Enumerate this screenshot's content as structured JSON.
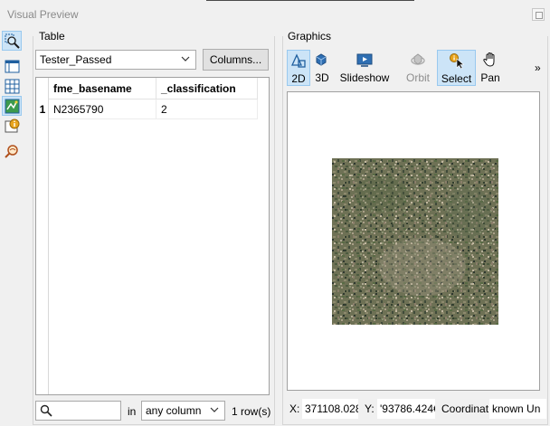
{
  "window": {
    "title": "Visual Preview"
  },
  "toolstrip": {
    "items": [
      {
        "icon": "zoom-selection-icon",
        "active": true
      },
      {
        "icon": "window-layout-icon",
        "active": false
      },
      {
        "icon": "table-view-icon",
        "active": false
      },
      {
        "icon": "graphics-view-icon",
        "active": false
      },
      {
        "icon": "feature-info-icon",
        "active": false
      },
      {
        "icon": "inspect-search-icon",
        "active": false
      }
    ]
  },
  "table_panel": {
    "label": "Table",
    "dataset_select": "Tester_Passed",
    "columns_button": "Columns...",
    "headers": [
      "fme_basename",
      "_classification"
    ],
    "rows": [
      {
        "num": "1",
        "cells": [
          "N2365790",
          "2"
        ]
      }
    ],
    "search": {
      "value": "",
      "in_label": "in",
      "scope": "any column",
      "row_count": "1 row(s)"
    }
  },
  "graphics_panel": {
    "label": "Graphics",
    "tools": [
      {
        "label": "2D",
        "icon": "view-2d-icon",
        "active": true,
        "enabled": true
      },
      {
        "label": "3D",
        "icon": "view-3d-icon",
        "active": false,
        "enabled": true
      },
      {
        "label": "Slideshow",
        "icon": "slideshow-icon",
        "active": false,
        "enabled": true
      },
      {
        "label": "Orbit",
        "icon": "orbit-icon",
        "active": false,
        "enabled": false
      },
      {
        "label": "Select",
        "icon": "select-pointer-icon",
        "active": true,
        "enabled": true
      },
      {
        "label": "Pan",
        "icon": "pan-hand-icon",
        "active": false,
        "enabled": true
      }
    ],
    "overflow": "»",
    "status": {
      "x_label": "X:",
      "x_value": "371108.028",
      "y_label": "Y:",
      "y_value": "'93786.424€",
      "coord_label": "Coordinat",
      "coord_value": "known Un"
    }
  },
  "colors": {
    "accent_bg": "#cce4f7",
    "accent_border": "#99c9ef",
    "raster_base": "#6f7358"
  }
}
